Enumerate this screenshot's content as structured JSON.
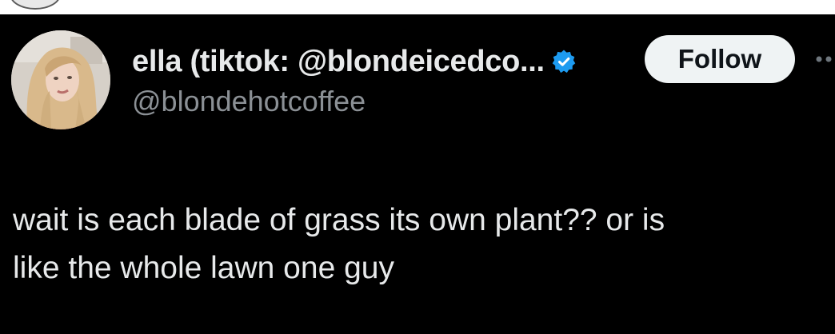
{
  "tweet": {
    "author": {
      "display_name": "ella (tiktok: @blondeicedco...",
      "handle": "@blondehotcoffee",
      "verified": true,
      "verified_badge_color": "#1d9bf0"
    },
    "follow_button_label": "Follow",
    "text": "wait is each blade of grass its own plant?? or is\nlike the whole lawn one guy"
  },
  "colors": {
    "background": "#000000",
    "primary_text": "#e7e9ea",
    "secondary_text": "#8b9095",
    "follow_button_bg": "#eff3f4",
    "follow_button_text": "#0f1419"
  },
  "icons": {
    "avatar": "profile-photo",
    "verified": "verified-badge-icon",
    "more": "more-options-icon"
  }
}
